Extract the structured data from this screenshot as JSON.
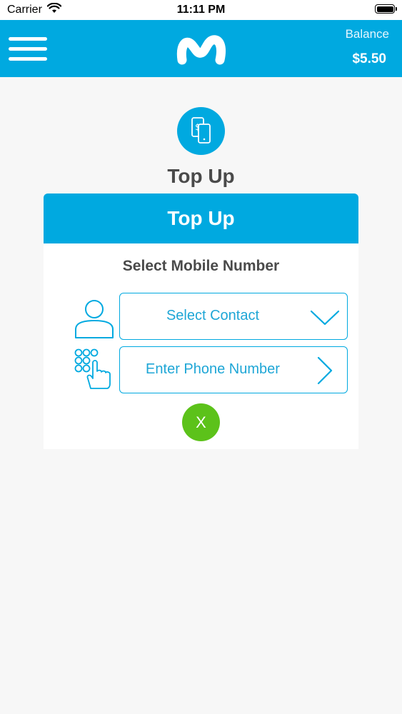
{
  "status_bar": {
    "carrier": "Carrier",
    "time": "11:11 PM"
  },
  "header": {
    "balance_label": "Balance",
    "balance_value": "$5.50",
    "accent_color": "#00a9e0"
  },
  "page": {
    "title": "Top Up"
  },
  "card": {
    "header_title": "Top Up",
    "subtitle": "Select Mobile Number",
    "select_contact_label": "Select Contact",
    "enter_phone_label": "Enter Phone Number",
    "close_label": "X",
    "close_color": "#5cc21a"
  },
  "icons": [
    "menu-icon",
    "brand-logo",
    "topup-phone-icon",
    "contact-person-icon",
    "keypad-hand-icon",
    "chevron-down-icon",
    "chevron-right-icon",
    "wifi-icon",
    "battery-icon"
  ]
}
